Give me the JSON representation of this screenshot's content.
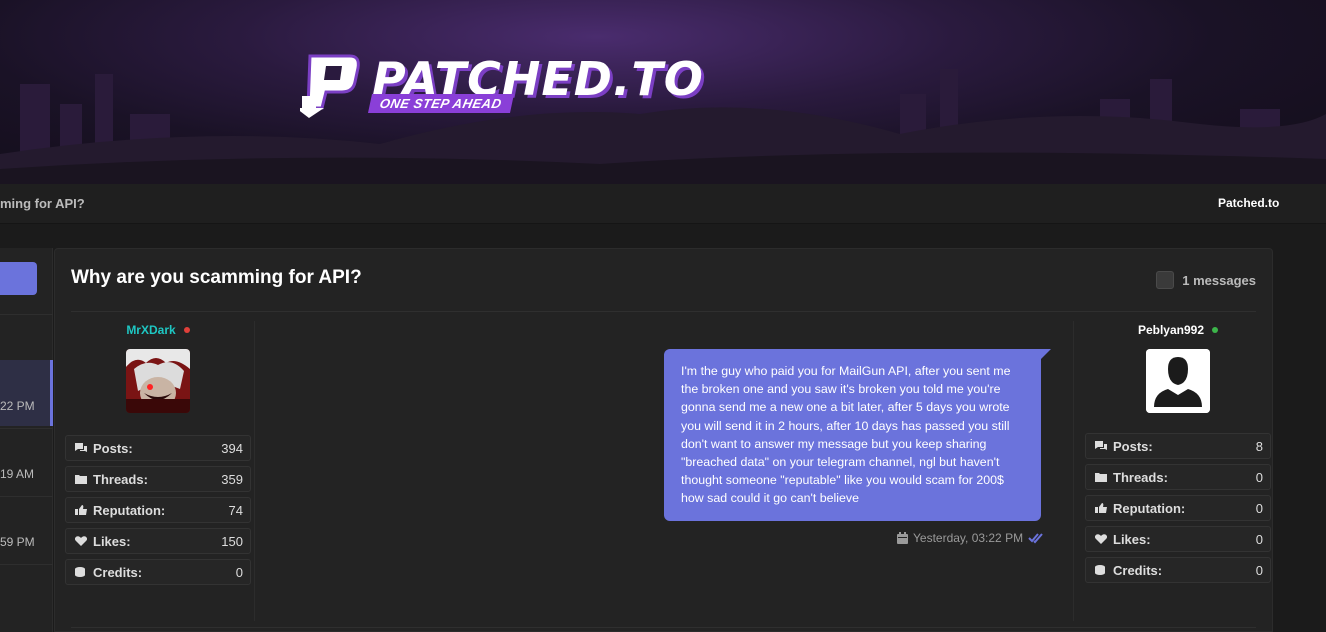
{
  "header": {
    "logo_text": "PATCHED.TO",
    "logo_tagline": "ONE STEP AHEAD"
  },
  "navbar": {
    "breadcrumb": "ming for API?",
    "site_link": "Patched.to"
  },
  "left_list": {
    "times": [
      "22 PM",
      "19 AM",
      "59 PM"
    ]
  },
  "conversation": {
    "title": "Why are you scamming for API?",
    "message_count": "1 messages",
    "participants": [
      {
        "username": "MrXDark",
        "status_color": "#e0403a",
        "name_color": "#1ec7c3",
        "stats": [
          {
            "icon": "comments-icon",
            "label": "Posts:",
            "value": "394"
          },
          {
            "icon": "folder-icon",
            "label": "Threads:",
            "value": "359"
          },
          {
            "icon": "thumbs-up-icon",
            "label": "Reputation:",
            "value": "74"
          },
          {
            "icon": "heart-icon",
            "label": "Likes:",
            "value": "150"
          },
          {
            "icon": "coins-icon",
            "label": "Credits:",
            "value": "0"
          }
        ]
      },
      {
        "username": "Peblyan992",
        "status_color": "#3cb54a",
        "name_color": "#ffffff",
        "stats": [
          {
            "icon": "comments-icon",
            "label": "Posts:",
            "value": "8"
          },
          {
            "icon": "folder-icon",
            "label": "Threads:",
            "value": "0"
          },
          {
            "icon": "thumbs-up-icon",
            "label": "Reputation:",
            "value": "0"
          },
          {
            "icon": "heart-icon",
            "label": "Likes:",
            "value": "0"
          },
          {
            "icon": "coins-icon",
            "label": "Credits:",
            "value": "0"
          }
        ]
      }
    ],
    "message": {
      "text": "I'm the guy who paid you for MailGun API, after you sent me the broken one and you saw it's broken you told me you're gonna send me a new one a bit later, after 5 days you wrote you will send it in 2 hours, after 10 days has passed you still don't want to answer my message but you keep sharing \"breached data\" on your telegram channel, ngl but haven't thought someone \"reputable\" like you would scam for 200$ how sad could it go can't believe",
      "timestamp": "Yesterday, 03:22 PM"
    }
  },
  "colors": {
    "accent": "#6b73dc",
    "background": "#1b1b1b",
    "panel": "#232323"
  }
}
